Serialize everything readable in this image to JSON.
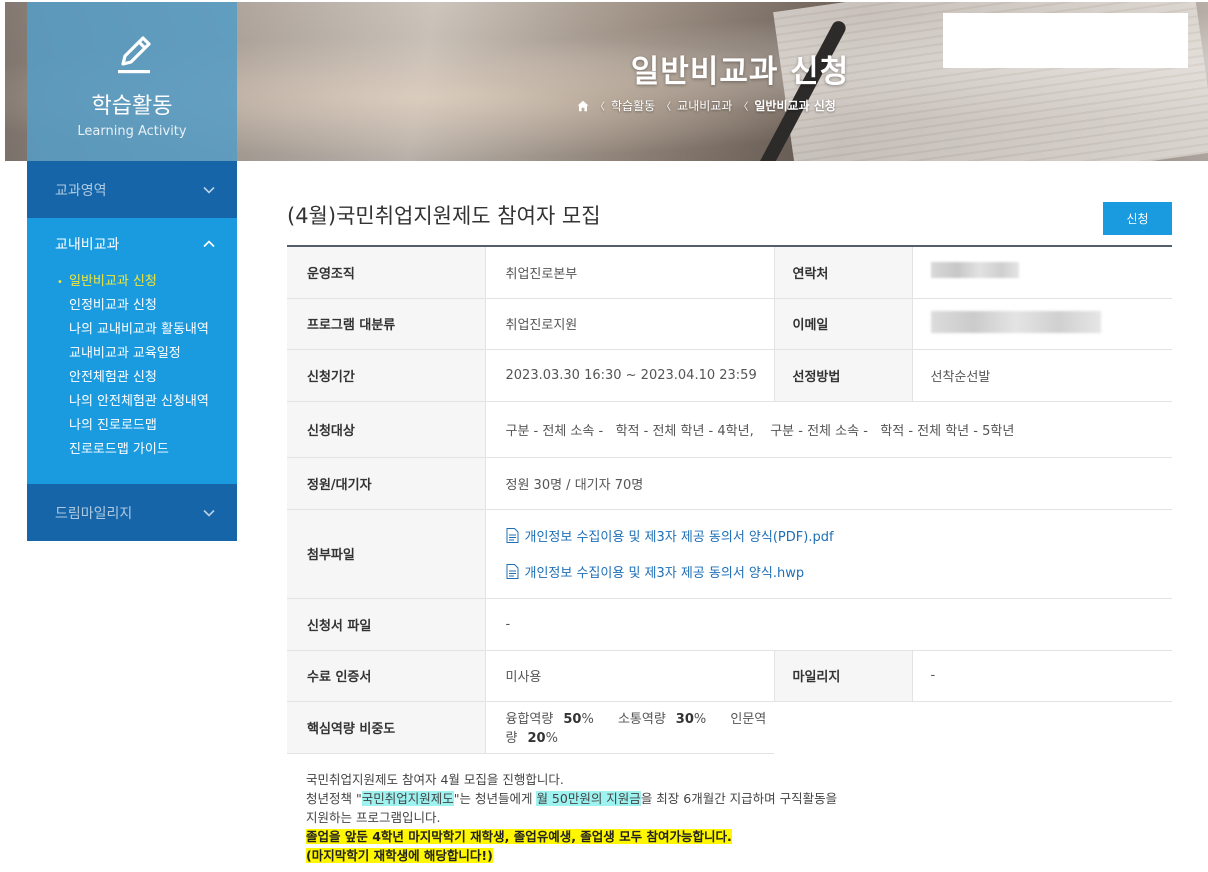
{
  "banner": {
    "title": "일반비교과 신청",
    "breadcrumb": [
      "학습활동",
      "교내비교과",
      "일반비교과 신청"
    ]
  },
  "sidebar": {
    "header_title": "학습활동",
    "header_subtitle": "Learning Activity",
    "sections": [
      {
        "label": "교과영역",
        "expanded": false
      },
      {
        "label": "교내비교과",
        "expanded": true
      },
      {
        "label": "드림마일리지",
        "expanded": false
      }
    ],
    "items": [
      {
        "label": "일반비교과 신청",
        "active": true
      },
      {
        "label": "인정비교과 신청"
      },
      {
        "label": "나의 교내비교과 활동내역"
      },
      {
        "label": "교내비교과 교육일정"
      },
      {
        "label": "안전체험관 신청"
      },
      {
        "label": "나의 안전체험관 신청내역"
      },
      {
        "label": "나의 진로로드맵"
      },
      {
        "label": "진로로드맵 가이드"
      }
    ]
  },
  "main": {
    "title": "(4월)국민취업지원제도 참여자 모집",
    "apply_label": "신청",
    "labels": {
      "org": "운영조직",
      "contact": "연락처",
      "category": "프로그램 대분류",
      "email": "이메일",
      "period": "신청기간",
      "selection": "선정방법",
      "target": "신청대상",
      "quota": "정원/대기자",
      "attachments": "첨부파일",
      "form_file": "신청서 파일",
      "certificate": "수료 인증서",
      "mileage": "마일리지",
      "competency": "핵심역량 비중도"
    },
    "values": {
      "org": "취업진로본부",
      "category": "취업진로지원",
      "period": "2023.03.30 16:30 ~ 2023.04.10 23:59",
      "selection": "선착순선발",
      "target": "구분 - 전체 소속 -   학적 - 전체 학년 - 4학년,    구분 - 전체 소속 -   학적 - 전체 학년 - 5학년",
      "quota": "정원 30명 / 대기자 70명",
      "attachments": [
        "개인정보 수집이용 및 제3자 제공 동의서 양식(PDF).pdf",
        "개인정보 수집이용 및 제3자 제공 동의서 양식.hwp"
      ],
      "form_file": "-",
      "certificate": "미사용",
      "mileage": "-",
      "competency": [
        {
          "name": "융합역량",
          "pct": "50",
          "unit": "%"
        },
        {
          "name": "소통역량",
          "pct": "30",
          "unit": "%"
        },
        {
          "name": "인문역량",
          "pct": "20",
          "unit": "%"
        }
      ]
    },
    "description": {
      "line1": "국민취업지원제도 참여자 4월 모집을 진행합니다.",
      "line2_a": "청년정책 \"",
      "line2_hl1": "국민취업지원제도",
      "line2_b": "\"는 청년들에게 ",
      "line2_hl2": "월 50만원의 지원금",
      "line2_c": "을 최장 6개월간 지급하며 구직활동을",
      "line3": "지원하는 프로그램입니다.",
      "line4": "졸업을 앞둔 4학년 마지막학기 재학생, 졸업유예생, 졸업생 모두 참여가능합니다.",
      "line5": "(마지막학기 재학생에 해당합니다!)"
    }
  }
}
